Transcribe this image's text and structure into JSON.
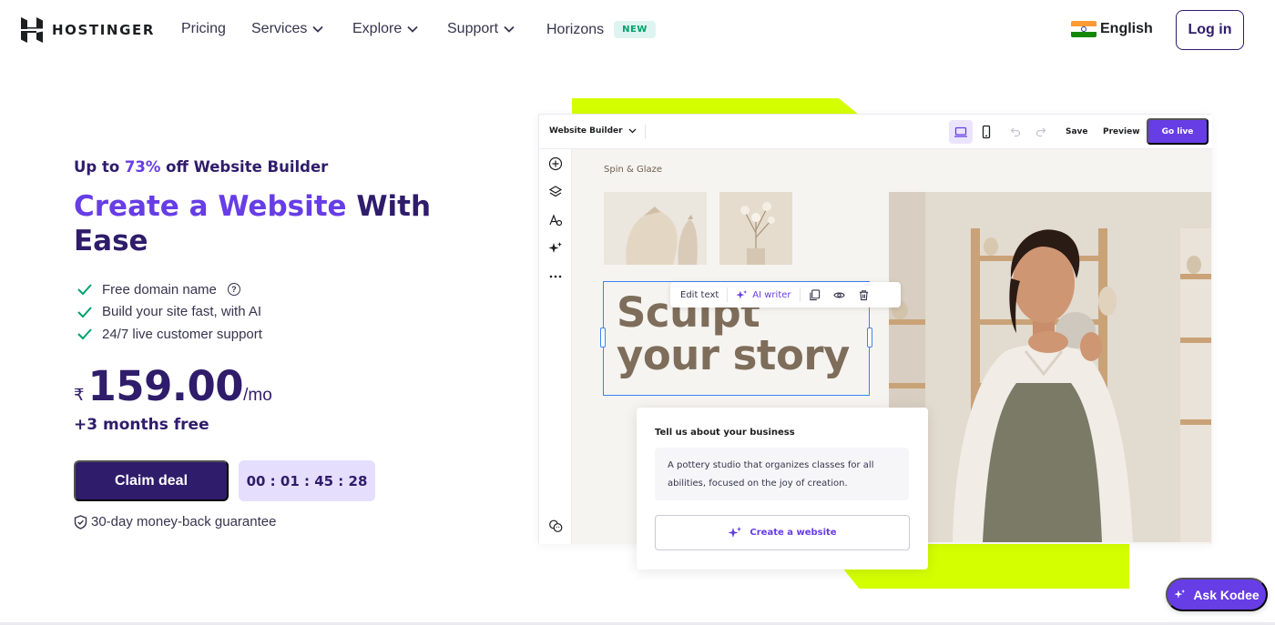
{
  "nav": {
    "brand": "HOSTINGER",
    "items": [
      {
        "label": "Pricing"
      },
      {
        "label": "Services"
      },
      {
        "label": "Explore"
      },
      {
        "label": "Support"
      },
      {
        "label": "Horizons"
      }
    ],
    "new_badge": "NEW",
    "language": "English",
    "login": "Log in"
  },
  "hero": {
    "subtitle_prefix": "Up to ",
    "subtitle_highlight": "73%",
    "subtitle_suffix": " off Website Builder",
    "headline_highlight": "Create a Website",
    "headline_rest": " With Ease",
    "features": [
      "Free domain name",
      "Build your site fast, with AI",
      "24/7 live customer support"
    ],
    "help_symbol": "?",
    "currency": "₹",
    "price": "159.00",
    "per": "/mo",
    "bonus": "+3 months free",
    "cta": "Claim deal",
    "timer": "00 : 01 : 45 : 28",
    "guarantee": "30-day money-back guarantee"
  },
  "builder": {
    "title": "Website Builder",
    "save": "Save",
    "preview": "Preview",
    "go_live": "Go live",
    "site_name": "Spin & Glaze",
    "edit_text": "Edit text",
    "ai_writer": "AI writer",
    "heading_line1": "Sculpt",
    "heading_line2": "your story",
    "tell_title": "Tell us about your business",
    "tell_text": "A pottery studio that organizes classes for all abilities, focused on the joy of creation.",
    "create": "Create a website"
  },
  "kodee": "Ask Kodee",
  "colors": {
    "brand": "#673de6",
    "dark": "#2f1c6a",
    "lime": "#d4ff00",
    "check": "#00a16a"
  }
}
